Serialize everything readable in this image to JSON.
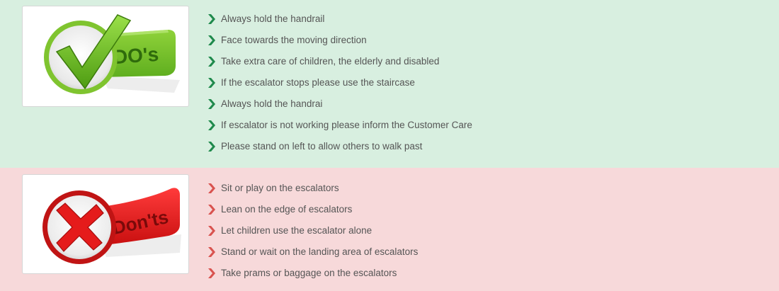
{
  "colors": {
    "dos_background": "#d8efe0",
    "donts_background": "#f7d9da",
    "dos_chevron": "#1f8a4c",
    "donts_chevron": "#d9534f",
    "text": "#555555"
  },
  "dos": {
    "badge_text": "DO's",
    "badge_icon": "checkmark-icon",
    "items": [
      "Always hold the handrail",
      "Face towards the moving direction",
      "Take extra care of children, the elderly and disabled",
      "If the escalator stops please use the staircase",
      "Always hold the handrai",
      "If escalator is not working please inform the Customer Care",
      "Please stand on left to allow others to walk past"
    ]
  },
  "donts": {
    "badge_text": "Don'ts",
    "badge_icon": "cross-icon",
    "items": [
      "Sit or play on the escalators",
      "Lean on the edge of escalators",
      "Let children use the escalator alone",
      "Stand or wait on the landing area of escalators",
      "Take prams or baggage on the escalators"
    ]
  }
}
